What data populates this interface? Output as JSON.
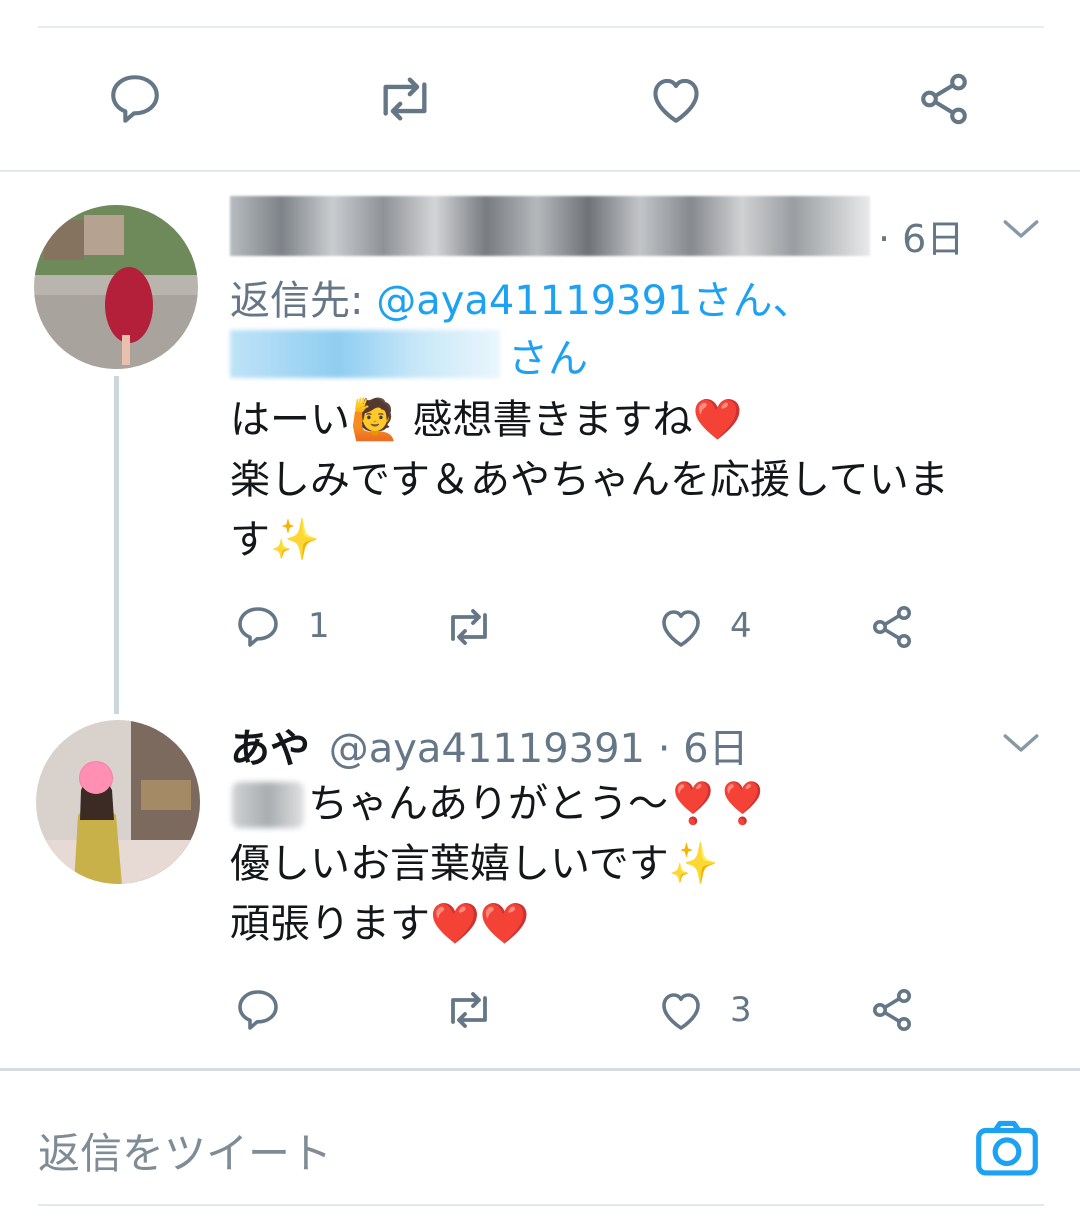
{
  "thread_actions": {
    "icons": [
      "reply-icon",
      "retweet-icon",
      "like-icon",
      "share-icon"
    ]
  },
  "reply1": {
    "time": "· 6日",
    "reply_to_label": "返信先: ",
    "reply_to_handle1": "@aya41119391さん、",
    "reply_to_handle2": "さん",
    "body_line1": "はーい🙋 感想書きますね❤️",
    "body_line2": "楽しみです＆あやちゃんを応援していま",
    "body_line3": "す✨",
    "reply_count": "1",
    "like_count": "4"
  },
  "reply2": {
    "display_name": "あや",
    "handle_time": "@aya41119391 · 6日",
    "body_line1": "ちゃんありがとう〜❣️❣️",
    "body_line2": "優しいお言葉嬉しいです✨",
    "body_line3": "頑張ります❤️❤️",
    "like_count": "3"
  },
  "composer": {
    "placeholder": "返信をツイート"
  },
  "colors": {
    "accent": "#1da1f2",
    "icon_gray": "#657786",
    "divider": "#e1e8ed",
    "thread_line": "#ccd6dd"
  }
}
